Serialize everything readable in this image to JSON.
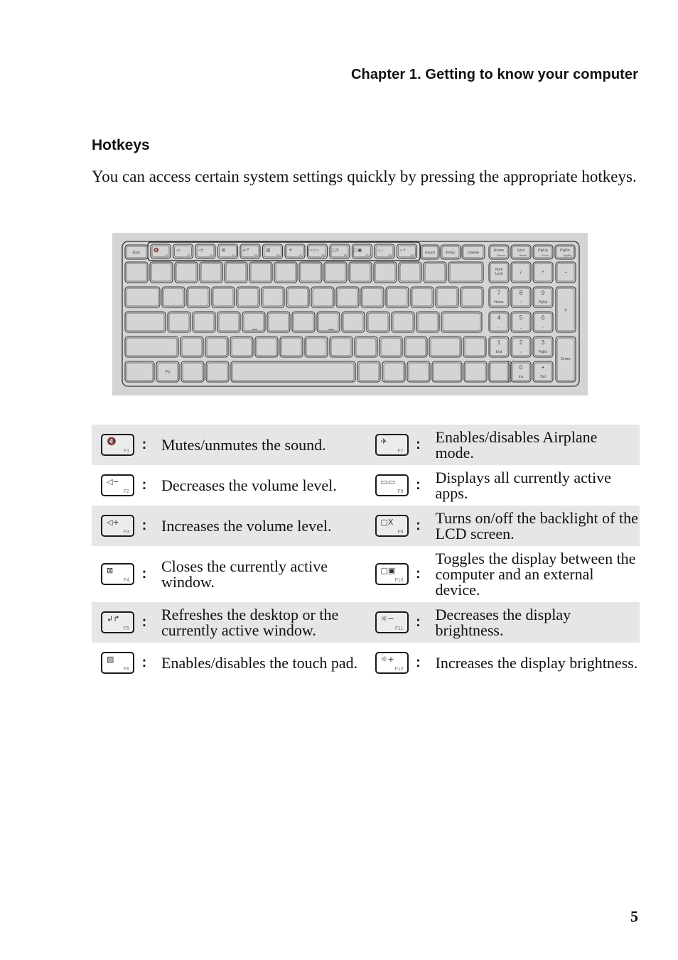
{
  "header": {
    "chapter_title": "Chapter 1. Getting to know your computer"
  },
  "section": {
    "title": "Hotkeys",
    "intro": "You can access certain system settings quickly by pressing the appropriate hotkeys."
  },
  "keyboard": {
    "fn_row": [
      {
        "label": "Esc"
      },
      {
        "label": "F1",
        "icon": "mute-icon",
        "glyph": "🔇"
      },
      {
        "label": "F2",
        "icon": "volume-down-icon",
        "glyph": "◁−"
      },
      {
        "label": "F3",
        "icon": "volume-up-icon",
        "glyph": "◁+"
      },
      {
        "label": "F4",
        "icon": "close-window-icon",
        "glyph": "⊠"
      },
      {
        "label": "F5",
        "icon": "refresh-icon",
        "glyph": "↲↱"
      },
      {
        "label": "F6",
        "icon": "touchpad-icon",
        "glyph": "▧"
      },
      {
        "label": "F7",
        "icon": "airplane-icon",
        "glyph": "✈"
      },
      {
        "label": "F8",
        "icon": "active-apps-icon",
        "glyph": "▭▭▭"
      },
      {
        "label": "F9",
        "icon": "backlight-off-icon",
        "glyph": "▢X"
      },
      {
        "label": "F10",
        "icon": "display-toggle-icon",
        "glyph": "▢▣"
      },
      {
        "label": "F11",
        "icon": "brightness-down-icon",
        "glyph": "☼−"
      },
      {
        "label": "F12",
        "icon": "brightness-up-icon",
        "glyph": "☼+"
      },
      {
        "label": "Insert"
      },
      {
        "label": "PrtSc"
      },
      {
        "label": "Delete"
      },
      {
        "label": "Home",
        "sub": "Pause"
      },
      {
        "label": "End",
        "sub": "Break"
      },
      {
        "label": "PgUp",
        "sub": "ScrLk"
      },
      {
        "label": "PgDn",
        "sub": "SysRq"
      }
    ],
    "fn_key_label": "Fn",
    "numpad": {
      "num_lock": "Num Lock",
      "slash": "/",
      "star": "*",
      "minus": "−",
      "plus": "+",
      "enter": "Enter",
      "keys": [
        {
          "main": "7",
          "sub": "Home"
        },
        {
          "main": "8",
          "sub": "↑"
        },
        {
          "main": "9",
          "sub": "PgUp"
        },
        {
          "main": "4",
          "sub": "←"
        },
        {
          "main": "5",
          "sub": "_"
        },
        {
          "main": "6",
          "sub": "→"
        },
        {
          "main": "1",
          "sub": "End"
        },
        {
          "main": "2",
          "sub": "↓"
        },
        {
          "main": "3",
          "sub": "PgDn"
        },
        {
          "main": "0",
          "sub": "Ins"
        },
        {
          "main": "•",
          "sub": "Del"
        }
      ]
    }
  },
  "hotkeys": [
    {
      "key": "F1",
      "glyph": "🔇",
      "icon": "mute-icon",
      "desc": "Mutes/unmutes the sound."
    },
    {
      "key": "F7",
      "glyph": "✈",
      "icon": "airplane-icon",
      "desc": "Enables/disables Airplane mode."
    },
    {
      "key": "F2",
      "glyph": "◁−",
      "icon": "volume-down-icon",
      "desc": "Decreases the volume level."
    },
    {
      "key": "F8",
      "glyph": "▭▭",
      "icon": "active-apps-icon",
      "desc": "Displays all currently active apps."
    },
    {
      "key": "F3",
      "glyph": "◁+",
      "icon": "volume-up-icon",
      "desc": "Increases the volume level."
    },
    {
      "key": "F9",
      "glyph": "▢X",
      "icon": "backlight-off-icon",
      "desc": "Turns on/off the backlight of the LCD screen."
    },
    {
      "key": "F4",
      "glyph": "⊠",
      "icon": "close-window-icon",
      "desc": "Closes the currently active window."
    },
    {
      "key": "F10",
      "glyph": "▢▣",
      "icon": "display-toggle-icon",
      "desc": "Toggles the display between the computer and an external device."
    },
    {
      "key": "F5",
      "glyph": "↲↱",
      "icon": "refresh-icon",
      "desc": "Refreshes the desktop or the currently active window."
    },
    {
      "key": "F11",
      "glyph": "☼−",
      "icon": "brightness-down-icon",
      "desc": "Decreases the display brightness."
    },
    {
      "key": "F6",
      "glyph": "▧",
      "icon": "touchpad-icon",
      "desc": "Enables/disables the touch pad."
    },
    {
      "key": "F12",
      "glyph": "☼+",
      "icon": "brightness-up-icon",
      "desc": "Increases the display brightness."
    }
  ],
  "separator": ":",
  "page_number": "5"
}
